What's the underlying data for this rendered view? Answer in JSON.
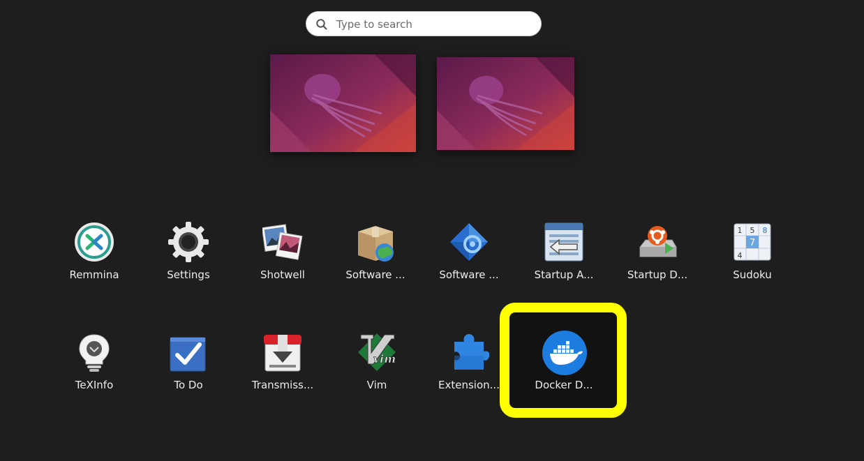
{
  "search": {
    "placeholder": "Type to search",
    "icon": "search-icon"
  },
  "workspaces": [
    {
      "name": "workspace-1"
    },
    {
      "name": "workspace-2"
    }
  ],
  "apps_row1": [
    {
      "label": "Remmina",
      "icon": "remmina-icon"
    },
    {
      "label": "Settings",
      "icon": "gear-icon"
    },
    {
      "label": "Shotwell",
      "icon": "shotwell-icon"
    },
    {
      "label": "Software ...",
      "icon": "software-properties-icon"
    },
    {
      "label": "Software ...",
      "icon": "software-updater-icon"
    },
    {
      "label": "Startup A...",
      "icon": "startup-applications-icon"
    },
    {
      "label": "Startup D...",
      "icon": "startup-disk-creator-icon"
    },
    {
      "label": "Sudoku",
      "icon": "sudoku-icon"
    }
  ],
  "apps_row2": [
    {
      "label": "TeXInfo",
      "icon": "lightbulb-icon"
    },
    {
      "label": "To Do",
      "icon": "todo-checkbox-icon"
    },
    {
      "label": "Transmiss...",
      "icon": "transmission-icon"
    },
    {
      "label": "Vim",
      "icon": "vim-icon"
    },
    {
      "label": "Extension...",
      "icon": "puzzle-icon"
    },
    {
      "label": "Docker D...",
      "icon": "docker-icon"
    }
  ],
  "sudoku_digits": [
    "1",
    "5",
    "8",
    "7",
    "4"
  ],
  "vim_text": "vim",
  "colors": {
    "background": "#1e1e1e",
    "highlight": "#ffff00",
    "docker_blue": "#1d7ce0"
  }
}
